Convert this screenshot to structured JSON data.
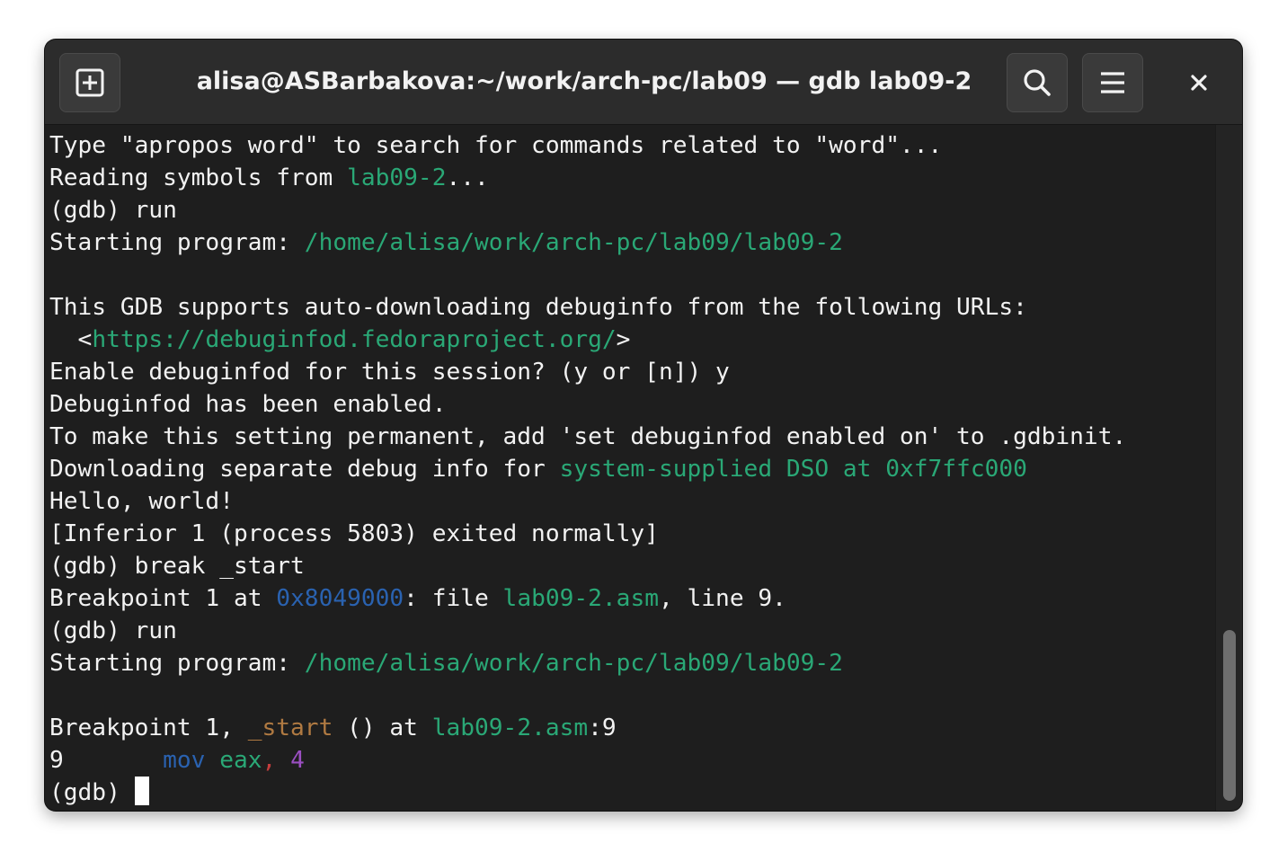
{
  "window": {
    "title": "alisa@ASBarbakova:~/work/arch-pc/lab09 — gdb lab09-2"
  },
  "headerbar": {
    "new_tab_icon": "new-tab-plus-icon",
    "search_icon": "search-icon",
    "menu_icon": "hamburger-menu-icon",
    "close_icon": "close-icon"
  },
  "colors": {
    "background": "#1e1e1e",
    "headerbar": "#2c2c2c",
    "text": "#f2f2f2",
    "green": "#2aa876",
    "blue": "#2a62b0",
    "orange": "#b07a42",
    "red": "#c43d3d",
    "purple": "#9b4fc2"
  },
  "terminal": {
    "lines": [
      [
        {
          "t": "Type \"apropos word\" to search for commands related to \"word\"..."
        }
      ],
      [
        {
          "t": "Reading symbols from "
        },
        {
          "t": "lab09-2",
          "c": "green"
        },
        {
          "t": "..."
        }
      ],
      [
        {
          "t": "(gdb) run"
        }
      ],
      [
        {
          "t": "Starting program: "
        },
        {
          "t": "/home/alisa/work/arch-pc/lab09/lab09-2",
          "c": "green"
        }
      ],
      [
        {
          "t": ""
        }
      ],
      [
        {
          "t": "This GDB supports auto-downloading debuginfo from the following URLs:"
        }
      ],
      [
        {
          "t": "  <"
        },
        {
          "t": "https://debuginfod.fedoraproject.org/",
          "c": "green"
        },
        {
          "t": ">"
        }
      ],
      [
        {
          "t": "Enable debuginfod for this session? (y or [n]) y"
        }
      ],
      [
        {
          "t": "Debuginfod has been enabled."
        }
      ],
      [
        {
          "t": "To make this setting permanent, add 'set debuginfod enabled on' to .gdbinit."
        }
      ],
      [
        {
          "t": "Downloading separate debug info for "
        },
        {
          "t": "system-supplied DSO at 0xf7ffc000",
          "c": "green"
        }
      ],
      [
        {
          "t": "Hello, world!"
        }
      ],
      [
        {
          "t": "[Inferior 1 (process 5803) exited normally]"
        }
      ],
      [
        {
          "t": "(gdb) break _start"
        }
      ],
      [
        {
          "t": "Breakpoint 1 at "
        },
        {
          "t": "0x8049000",
          "c": "blue"
        },
        {
          "t": ": file "
        },
        {
          "t": "lab09-2.asm",
          "c": "green"
        },
        {
          "t": ", line 9."
        }
      ],
      [
        {
          "t": "(gdb) run"
        }
      ],
      [
        {
          "t": "Starting program: "
        },
        {
          "t": "/home/alisa/work/arch-pc/lab09/lab09-2",
          "c": "green"
        }
      ],
      [
        {
          "t": ""
        }
      ],
      [
        {
          "t": "Breakpoint 1, "
        },
        {
          "t": "_start",
          "c": "orange"
        },
        {
          "t": " () at "
        },
        {
          "t": "lab09-2.asm",
          "c": "green"
        },
        {
          "t": ":9"
        }
      ],
      [
        {
          "t": "9       "
        },
        {
          "t": "mov",
          "c": "blue"
        },
        {
          "t": " "
        },
        {
          "t": "eax",
          "c": "green"
        },
        {
          "t": ",",
          "c": "red"
        },
        {
          "t": " "
        },
        {
          "t": "4",
          "c": "purple"
        }
      ]
    ],
    "prompt": "(gdb) "
  },
  "scrollbar": {
    "position_fraction": 0.75,
    "visible_fraction": 0.25
  }
}
